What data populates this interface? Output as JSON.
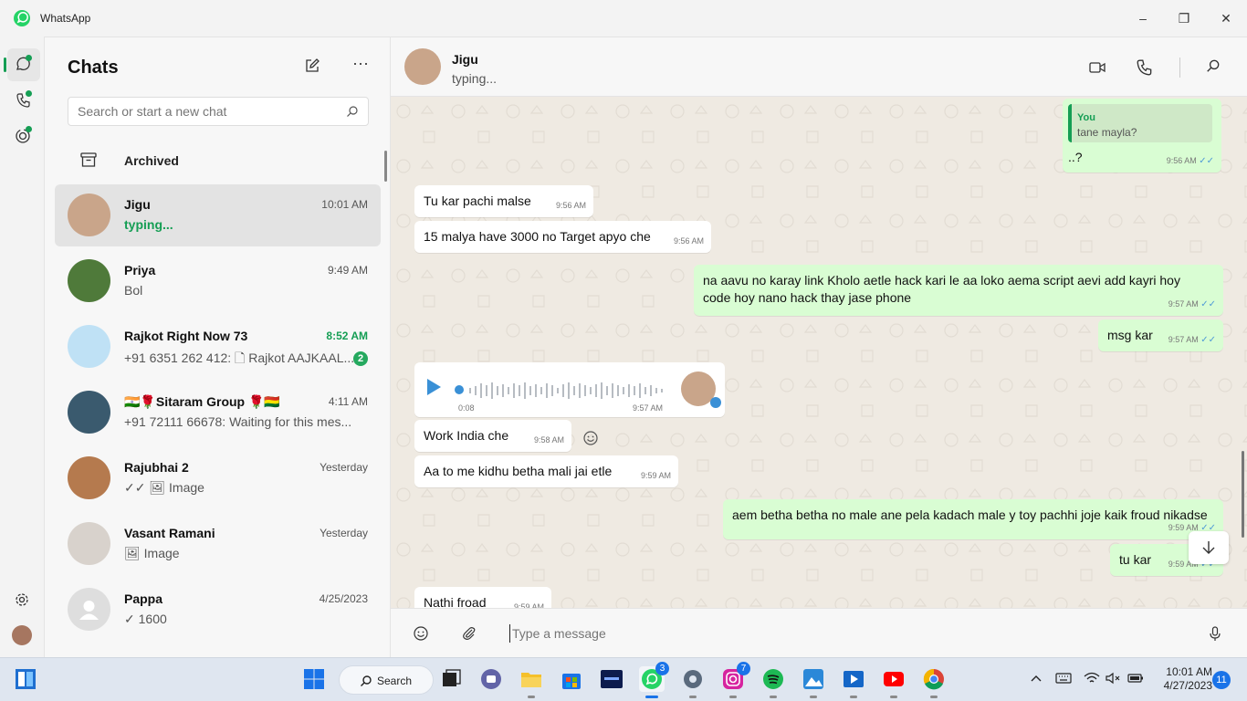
{
  "window": {
    "title": "WhatsApp",
    "minimize": "–",
    "maximize": "❐",
    "close": "✕"
  },
  "sidebar": {
    "title": "Chats",
    "more_label": "···",
    "search_placeholder": "Search or start a new chat",
    "archived_label": "Archived",
    "chats": [
      {
        "name": "Jigu",
        "time": "10:01 AM",
        "preview": "typing...",
        "selected": true,
        "preview_green": true
      },
      {
        "name": "Priya",
        "time": "9:49 AM",
        "preview": "Bol"
      },
      {
        "name": "Rajkot Right Now 73",
        "time": "8:52 AM",
        "preview": "+91 6351 262 412: 🗋 Rajkot AAJKAAL...",
        "badge": "2",
        "time_green": true
      },
      {
        "name": "🇮🇳🌹Sitaram Group 🌹🇧🇴",
        "time": "4:11 AM",
        "preview": "+91 72111 66678: Waiting for this mes..."
      },
      {
        "name": "Rajubhai 2",
        "time": "Yesterday",
        "preview": "✓✓ 🖼 Image"
      },
      {
        "name": "Vasant Ramani",
        "time": "Yesterday",
        "preview": "🖼 Image"
      },
      {
        "name": "Pappa",
        "time": "4/25/2023",
        "preview": "✓ 1600"
      }
    ]
  },
  "chat": {
    "contact_name": "Jigu",
    "status": "typing...",
    "composer_placeholder": "Type a message",
    "messages": [
      {
        "dir": "out",
        "quote_author": "You",
        "quote_text": "tane mayla?",
        "text": "..?",
        "time": "9:56 AM"
      },
      {
        "dir": "in",
        "text": "Tu kar pachi malse",
        "time": "9:56 AM"
      },
      {
        "dir": "in",
        "text": "15 malya have 3000 no Target apyo che",
        "time": "9:56 AM"
      },
      {
        "dir": "out",
        "text": "na aavu no karay link Kholo aetle hack kari le aa loko aema script aevi add kayri hoy code hoy nano hack thay jase phone",
        "time": "9:57 AM"
      },
      {
        "dir": "out",
        "text": "msg kar",
        "time": "9:57 AM"
      },
      {
        "dir": "in",
        "type": "voice",
        "duration": "0:08",
        "time": "9:57 AM"
      },
      {
        "dir": "in",
        "text": "Work India che",
        "time": "9:58 AM"
      },
      {
        "dir": "in",
        "text": "Aa to me kidhu betha mali jai etle",
        "time": "9:59 AM"
      },
      {
        "dir": "out",
        "text": "aem betha betha no male ane pela kadach male y toy pachhi joje kaik froud nikadse",
        "time": "9:59 AM"
      },
      {
        "dir": "out",
        "text": "tu kar",
        "time": "9:59 AM"
      },
      {
        "dir": "in",
        "text": "Nathi froad",
        "time": "9:59 AM"
      }
    ]
  },
  "taskbar": {
    "search_label": "Search",
    "whatsapp_badge": "3",
    "instagram_badge": "7",
    "clock_time": "10:01 AM",
    "clock_date": "4/27/2023",
    "notifications": "11"
  },
  "colors": {
    "accent": "#159e54",
    "outgoing_bubble": "#d9fdd3",
    "incoming_bubble": "#ffffff",
    "chat_bg": "#efeae2",
    "tick_blue": "#4f9ad6"
  }
}
